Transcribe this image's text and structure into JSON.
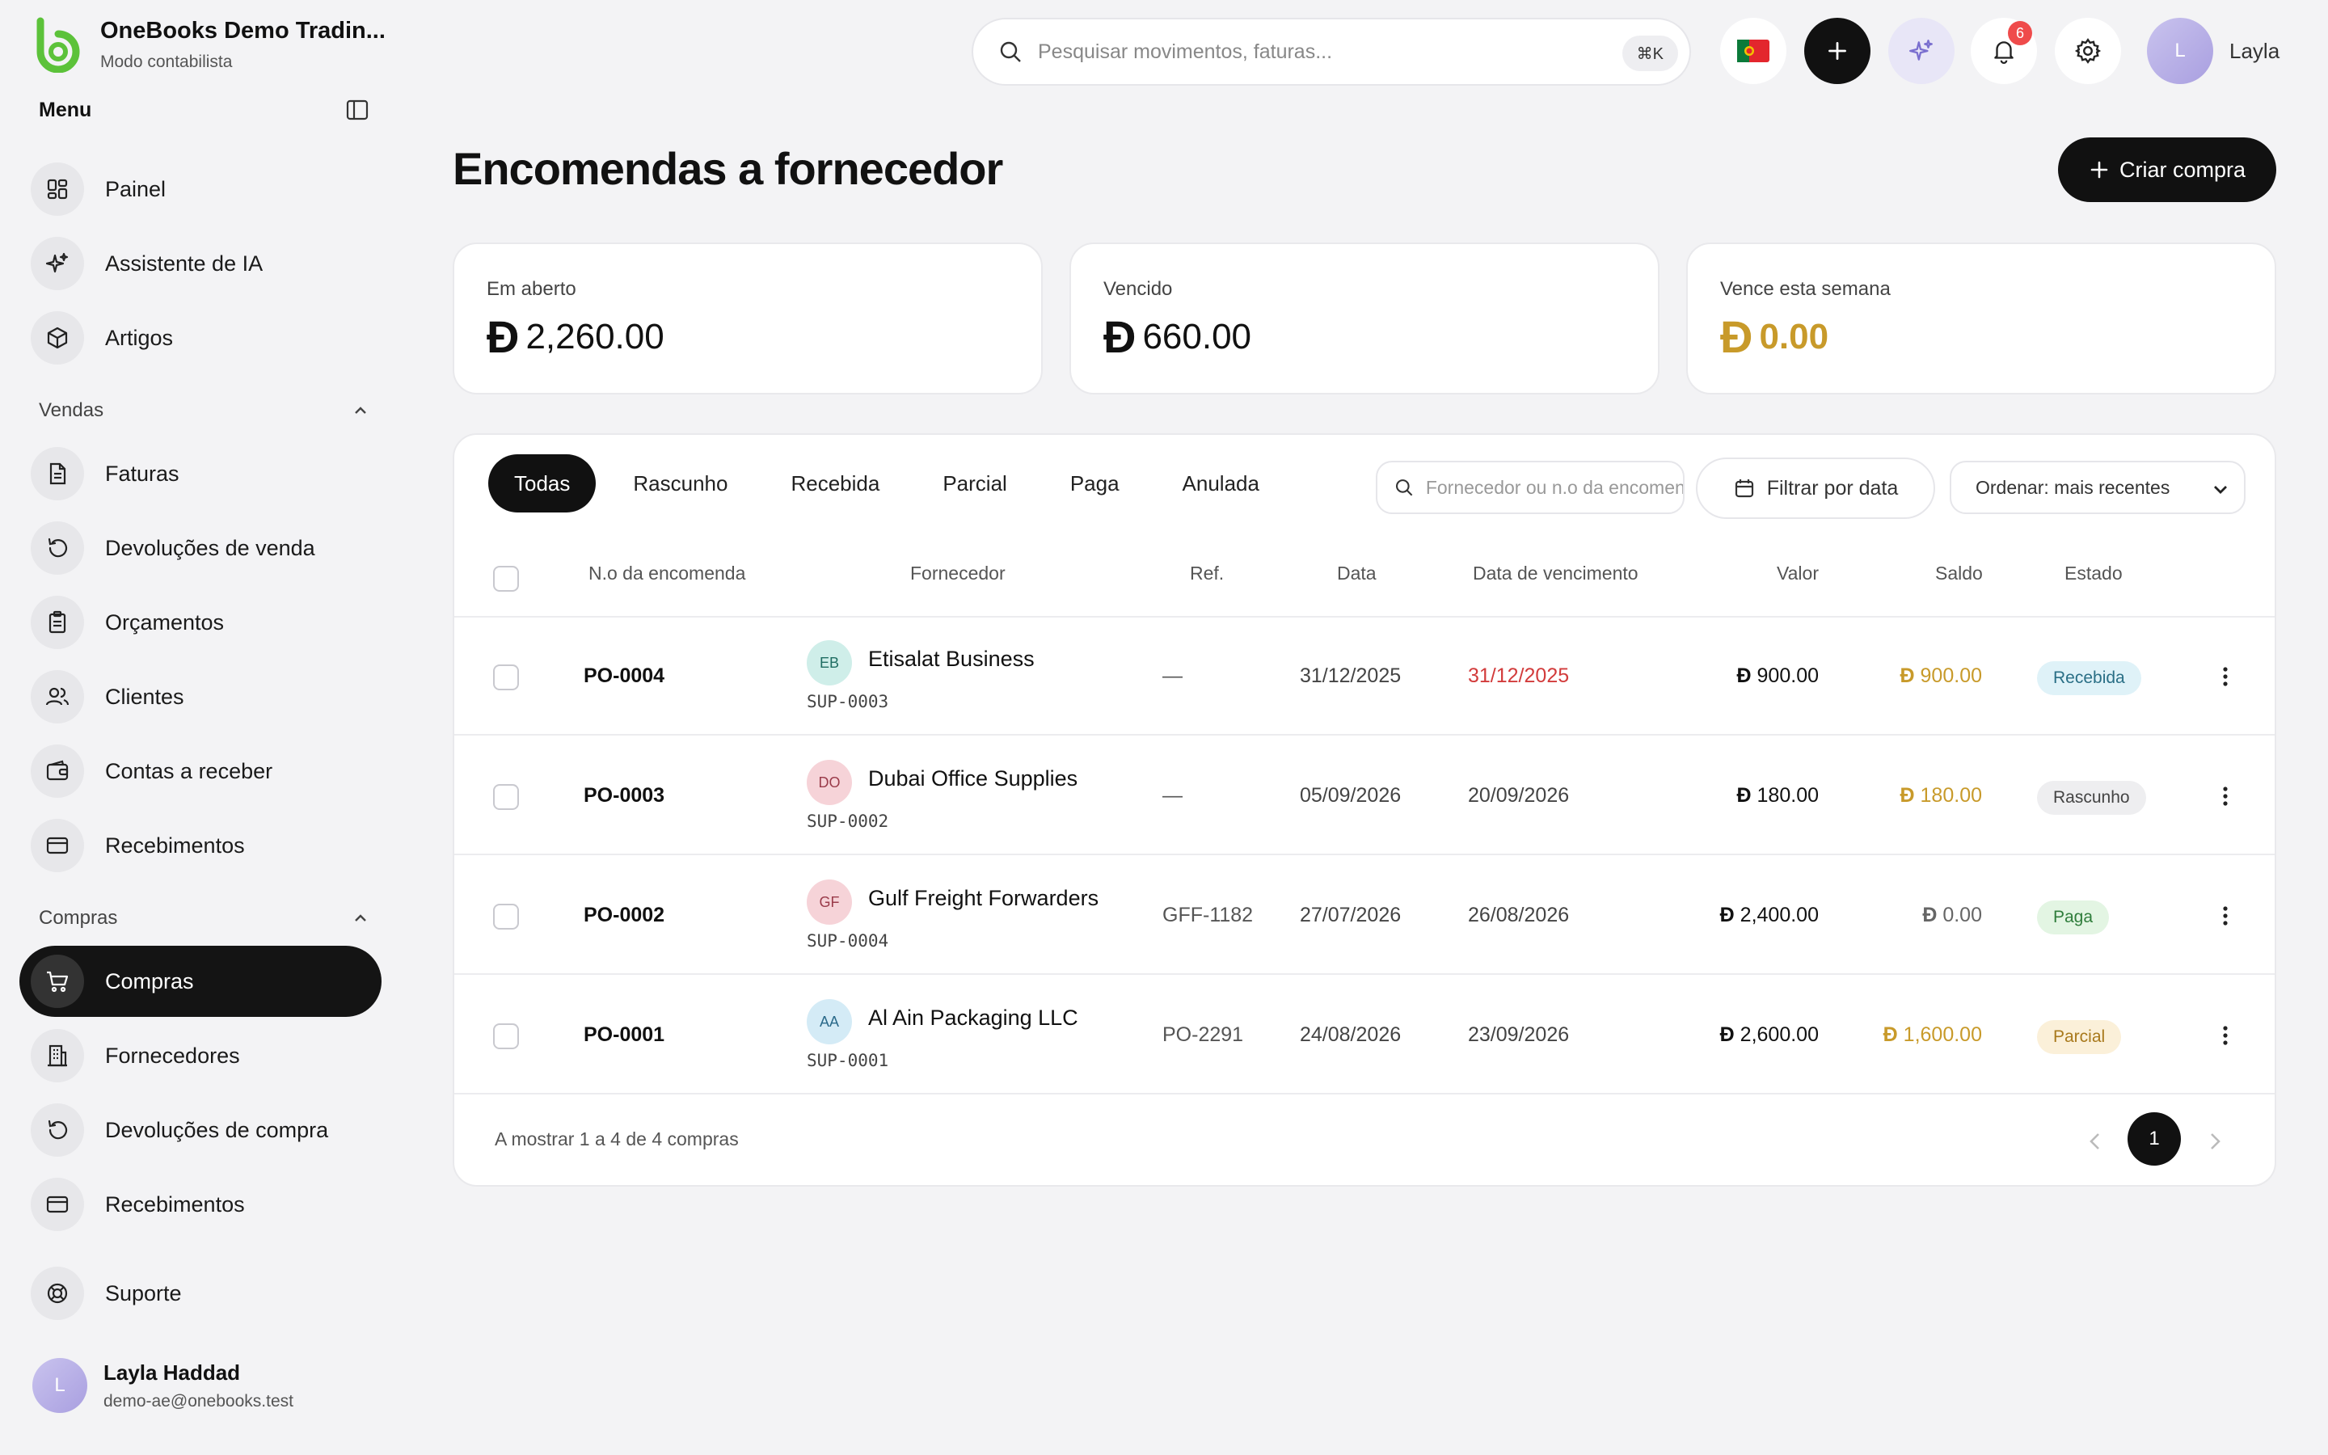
{
  "brand": {
    "name": "OneBooks Demo Tradin...",
    "mode": "Modo contabilista",
    "color": "#5cc23a"
  },
  "menu": {
    "title": "Menu"
  },
  "nav": {
    "top": [
      {
        "label": "Painel",
        "icon": "dashboard-icon"
      },
      {
        "label": "Assistente de IA",
        "icon": "sparkles-icon"
      },
      {
        "label": "Artigos",
        "icon": "box-icon"
      }
    ],
    "vendas": {
      "title": "Vendas",
      "items": [
        {
          "label": "Faturas",
          "icon": "document-icon"
        },
        {
          "label": "Devoluções de venda",
          "icon": "undo-icon"
        },
        {
          "label": "Orçamentos",
          "icon": "clipboard-icon"
        },
        {
          "label": "Clientes",
          "icon": "users-icon"
        },
        {
          "label": "Contas a receber",
          "icon": "wallet-icon"
        },
        {
          "label": "Recebimentos",
          "icon": "card-icon"
        }
      ]
    },
    "compras": {
      "title": "Compras",
      "items": [
        {
          "label": "Compras",
          "icon": "cart-icon"
        },
        {
          "label": "Fornecedores",
          "icon": "building-icon"
        },
        {
          "label": "Devoluções de compra",
          "icon": "undo-icon"
        },
        {
          "label": "Recebimentos",
          "icon": "card-icon"
        }
      ]
    },
    "support": {
      "label": "Suporte",
      "icon": "lifebuoy-icon"
    }
  },
  "user": {
    "initial": "L",
    "name": "Layla Haddad",
    "email": "demo-ae@onebooks.test",
    "short_name": "Layla"
  },
  "topbar": {
    "search_placeholder": "Pesquisar movimentos, faturas...",
    "shortcut": "⌘K",
    "notifications": "6"
  },
  "page": {
    "title": "Encomendas a fornecedor",
    "create_label": "Criar compra"
  },
  "currency_symbol": "Ð",
  "stats": [
    {
      "label": "Em aberto",
      "value": "2,260.00"
    },
    {
      "label": "Vencido",
      "value": "660.00"
    },
    {
      "label": "Vence esta semana",
      "value": "0.00"
    }
  ],
  "tabs": [
    "Todas",
    "Rascunho",
    "Recebida",
    "Parcial",
    "Paga",
    "Anulada"
  ],
  "filters": {
    "search_placeholder": "Fornecedor ou n.o da encomenda",
    "date_label": "Filtrar por data",
    "sort_label": "Ordenar: mais recentes"
  },
  "columns": {
    "number": "N.o da encomenda",
    "supplier": "Fornecedor",
    "ref": "Ref.",
    "date": "Data",
    "due": "Data de vencimento",
    "amount": "Valor",
    "balance": "Saldo",
    "status": "Estado"
  },
  "rows": [
    {
      "number": "PO-0004",
      "initials": "EB",
      "supplier": "Etisalat Business",
      "code": "SUP-0003",
      "ref": "—",
      "date": "31/12/2025",
      "due": "31/12/2025",
      "amount": "900.00",
      "balance": "900.00",
      "status": "Recebida"
    },
    {
      "number": "PO-0003",
      "initials": "DO",
      "supplier": "Dubai Office Supplies",
      "code": "SUP-0002",
      "ref": "—",
      "date": "05/09/2026",
      "due": "20/09/2026",
      "amount": "180.00",
      "balance": "180.00",
      "status": "Rascunho"
    },
    {
      "number": "PO-0002",
      "initials": "GF",
      "supplier": "Gulf Freight Forwarders",
      "code": "SUP-0004",
      "ref": "GFF-1182",
      "date": "27/07/2026",
      "due": "26/08/2026",
      "amount": "2,400.00",
      "balance": "0.00",
      "status": "Paga"
    },
    {
      "number": "PO-0001",
      "initials": "AA",
      "supplier": "Al Ain Packaging LLC",
      "code": "SUP-0001",
      "ref": "PO-2291",
      "date": "24/08/2026",
      "due": "23/09/2026",
      "amount": "2,600.00",
      "balance": "1,600.00",
      "status": "Parcial"
    }
  ],
  "footer": {
    "summary": "A mostrar 1 a 4 de 4 compras",
    "page": "1"
  }
}
